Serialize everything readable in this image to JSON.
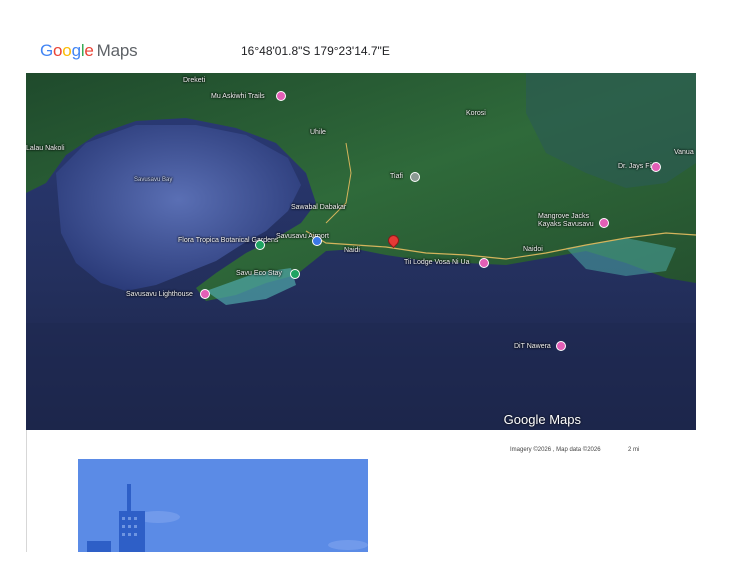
{
  "header": {
    "logo_text": "Google Maps",
    "logo_letters": [
      "G",
      "o",
      "o",
      "g",
      "l",
      "e"
    ],
    "logo_maps": "Maps",
    "coordinates": "16°48'01.8\"S 179°23'14.7\"E"
  },
  "map": {
    "watermark": "Google Maps",
    "labels": [
      {
        "id": "lbl-1",
        "text": "Dreketi"
      },
      {
        "id": "lbl-2",
        "text": "Mu Askiwhi Trails"
      },
      {
        "id": "lbl-3",
        "text": "Uhile"
      },
      {
        "id": "lbl-4",
        "text": "Korosi"
      },
      {
        "id": "lbl-5",
        "text": "Tiafi"
      },
      {
        "id": "lbl-6",
        "text": "Sawabal Dabakar"
      },
      {
        "id": "lbl-7",
        "text": "Savusavu Airport"
      },
      {
        "id": "lbl-8",
        "text": "Naidi"
      },
      {
        "id": "lbl-9",
        "text": "Flora Tropica Botanical Gardens"
      },
      {
        "id": "lbl-10",
        "text": "Savu Eco Stay"
      },
      {
        "id": "lbl-11",
        "text": "Savusavu Lighthouse"
      },
      {
        "id": "lbl-12",
        "text": "Tii Lodge Vosa Ni Ua"
      },
      {
        "id": "lbl-13",
        "text": "Naidoi"
      },
      {
        "id": "lbl-14",
        "text": "Mangrove Jacks Kayaks Savusavu"
      },
      {
        "id": "lbl-15",
        "text": "Dr. Jays Fiji"
      },
      {
        "id": "lbl-16",
        "text": "Vanua"
      },
      {
        "id": "lbl-17",
        "text": "DiT Nawera"
      },
      {
        "id": "lbl-18",
        "text": "Savusavu Bay"
      },
      {
        "id": "lbl-19",
        "text": "Lalau Nakoli"
      }
    ]
  },
  "footer": {
    "imagery": "Imagery ©2026 , Map data ©2026",
    "scale": "2 mi"
  },
  "colors": {
    "ocean_deep": "#1f2a4a",
    "land_green": "#2e5a35",
    "promo_blue": "#5b8be6",
    "marker_red": "#e53935"
  }
}
